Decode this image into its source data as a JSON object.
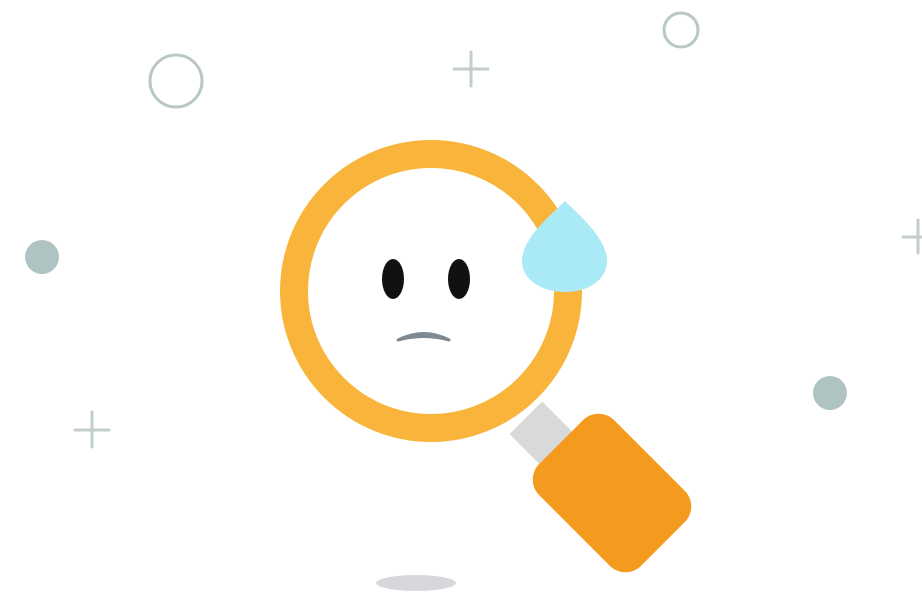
{
  "illustration": {
    "subject": "sad-magnifying-glass",
    "icons": [
      "magnifying-glass-icon",
      "sweat-drop-icon",
      "sad-face-icon"
    ]
  },
  "colors": {
    "background": "#ffffff",
    "lens_ring": "#F9B43B",
    "handle": "#F49B1F",
    "handle_neck": "#D9D9D9",
    "sweat_drop": "#A9EAF6",
    "eyes": "#111111",
    "mouth": "#7E8A93",
    "shadow": "#D8D8DC",
    "decoration": "#B9C7C7",
    "decoration_dot": "#AFC3C3"
  }
}
